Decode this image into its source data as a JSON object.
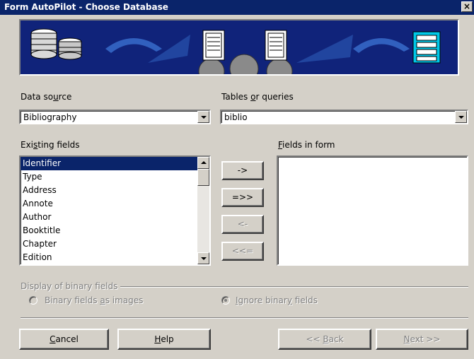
{
  "window": {
    "title": "Form AutoPilot - Choose Database",
    "close_glyph": "×"
  },
  "banner": {
    "icons": [
      "database-icon",
      "gear-icon",
      "document-icon",
      "form-list-icon"
    ],
    "colors": {
      "background": "#10237a",
      "arrow": "#3a6fd0"
    }
  },
  "data_source": {
    "label_before": "Data so",
    "label_ul": "u",
    "label_after": "rce",
    "value": "Bibliography"
  },
  "tables": {
    "label_before": "Tables ",
    "label_ul": "o",
    "label_after": "r queries",
    "value": "biblio"
  },
  "existing_fields": {
    "label_before": "Exi",
    "label_ul": "s",
    "label_after": "ting fields",
    "items": [
      "Identifier",
      "Type",
      "Address",
      "Annote",
      "Author",
      "Booktitle",
      "Chapter",
      "Edition"
    ],
    "selected": "Identifier"
  },
  "fields_in_form": {
    "label_ul": "F",
    "label_after": "ields in form"
  },
  "transfer_buttons": {
    "add_one": "->",
    "add_all": "=>>",
    "remove_one": "<-",
    "remove_all": "<<="
  },
  "binary": {
    "group_label": "Display of binary fields",
    "as_images_before": "Binary fields ",
    "as_images_ul": "a",
    "as_images_after": "s images",
    "ignore_before": "",
    "ignore_ul": "I",
    "ignore_after": "gnore binar",
    "ignore_ul2": "y",
    "ignore_after2": " fields"
  },
  "footer": {
    "cancel_ul": "C",
    "cancel_after": "ancel",
    "help_ul": "H",
    "help_after": "elp",
    "back_before": "<< ",
    "back_ul": "B",
    "back_after": "ack",
    "next_ul": "N",
    "next_after": "ext >>"
  }
}
